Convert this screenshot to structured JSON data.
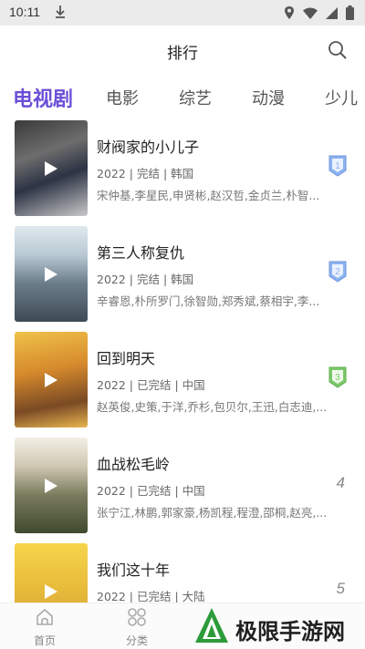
{
  "status_bar": {
    "time": "10:11"
  },
  "header": {
    "title": "排行",
    "search_icon": "search-icon"
  },
  "tabs": [
    {
      "label": "电视剧",
      "active": true
    },
    {
      "label": "电影",
      "active": false
    },
    {
      "label": "综艺",
      "active": false
    },
    {
      "label": "动漫",
      "active": false
    },
    {
      "label": "少儿",
      "active": false
    }
  ],
  "colors": {
    "accent": "#6a4fd6",
    "badge_blue": "#8cb2f0",
    "badge_green": "#7bc96a"
  },
  "items": [
    {
      "title": "财阀家的小儿子",
      "meta": "2022 | 完结 | 韩国",
      "cast": "宋仲基,李星民,申贤彬,赵汉哲,金贞兰,朴智...",
      "rank": "1"
    },
    {
      "title": "第三人称复仇",
      "meta": "2022 | 完结 | 韩国",
      "cast": "辛睿恩,朴所罗门,徐智勋,郑秀斌,蔡相宇,李...",
      "rank": "2"
    },
    {
      "title": "回到明天",
      "meta": "2022 | 已完结 | 中国",
      "cast": "赵英俊,史策,于洋,乔杉,包贝尔,王迅,白志迪,...",
      "rank": "3"
    },
    {
      "title": "血战松毛岭",
      "meta": "2022 | 已完结 | 中国",
      "cast": "张宁江,林鹏,郭家豪,杨凯程,程澄,邵桐,赵亮,...",
      "rank": "4"
    },
    {
      "title": "我们这十年",
      "meta": "2022 | 已完结 | 大陆",
      "cast": "",
      "rank": "5"
    }
  ],
  "bottom_nav": [
    {
      "label": "首页"
    },
    {
      "label": "分类"
    }
  ],
  "watermark": {
    "text": "极限手游网"
  }
}
